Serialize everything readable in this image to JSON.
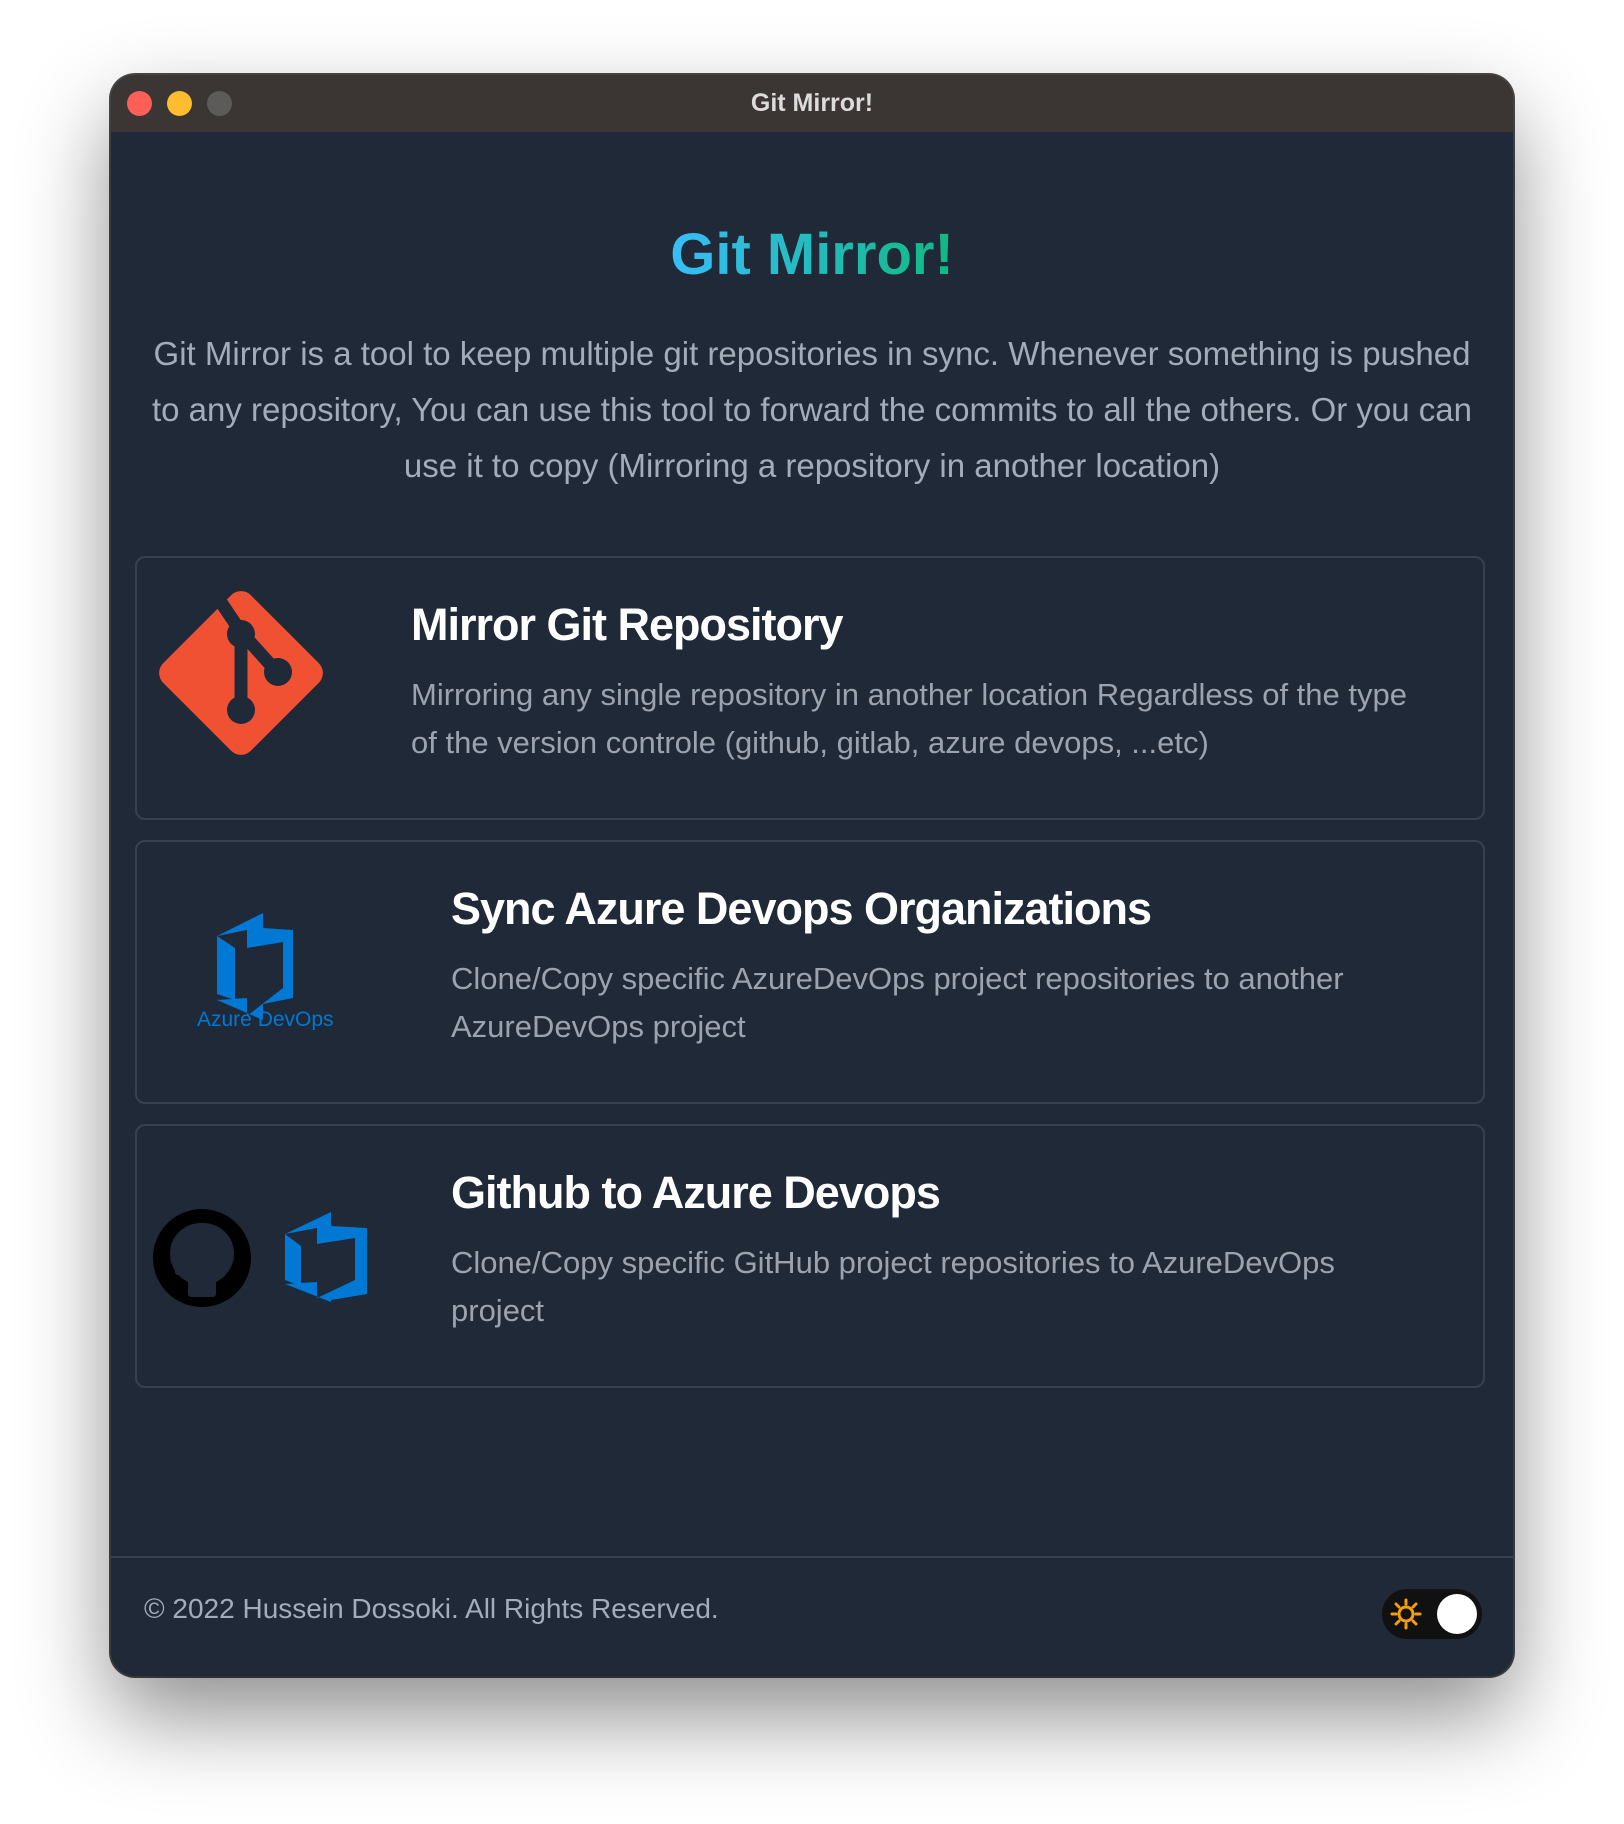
{
  "window": {
    "title": "Git Mirror!"
  },
  "header": {
    "heading": "Git Mirror!",
    "intro": "Git Mirror is a tool to keep multiple git repositories in sync. Whenever something is pushed to any repository, You can use this tool to forward the commits to all the others. Or you can use it to copy (Mirroring a repository in another location)"
  },
  "cards": [
    {
      "title": "Mirror Git Repository",
      "description": "Mirroring any single repository in another location Regardless of the type of the version controle (github, gitlab, azure devops, ...etc)",
      "icon": "git-logo-icon"
    },
    {
      "title": "Sync Azure Devops Organizations",
      "description": "Clone/Copy specific AzureDevOps project repositories to another AzureDevOps project",
      "icon": "azure-devops-logo-icon",
      "logo_text": "Azure DevOps"
    },
    {
      "title": "Github to Azure Devops",
      "description": "Clone/Copy specific GitHub project repositories to AzureDevOps project",
      "icons": [
        "github-logo-icon",
        "azure-devops-icon"
      ]
    }
  ],
  "footer": {
    "copyright": "© 2022 Hussein Dossoki. All Rights Reserved.",
    "theme_toggle_icon": "sun-icon",
    "theme_toggle_on": true
  },
  "colors": {
    "background": "#1f2937",
    "titlebar": "#3b3533",
    "git_orange": "#f05133",
    "azure_blue": "#0078d4",
    "heading_gradient_start": "#38bdf8",
    "heading_gradient_end": "#10b981",
    "sun_orange": "#f59e0b"
  }
}
